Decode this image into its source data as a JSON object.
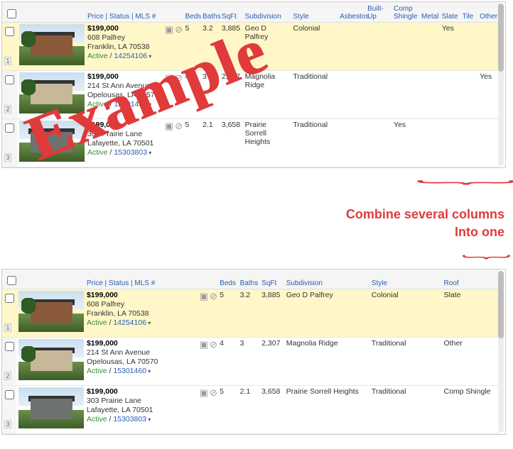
{
  "top": {
    "headers": {
      "price_status_mls": "Price | Status | MLS #",
      "beds": "Beds",
      "baths": "Baths",
      "sqft": "SqFt",
      "subdivision": "Subdivision",
      "style": "Style",
      "asbestos": "Asbestos",
      "builtup": "Built-Up",
      "comp_shingle": "Comp Shingle",
      "metal": "Metal",
      "slate": "Slate",
      "tile": "Tile",
      "other": "Other"
    },
    "rows": [
      {
        "num": "1",
        "price": "$199,000",
        "addr1": "608 Palfrey",
        "addr2": "Franklin, LA 70538",
        "status": "Active",
        "sep": " / ",
        "mls": "14254106",
        "beds": "5",
        "baths": "3.2",
        "sqft": "3,885",
        "subdivision": "Geo D Palfrey",
        "style": "Colonial",
        "asbestos": "",
        "builtup": "",
        "comp": "",
        "metal": "",
        "slate": "Yes",
        "tile": "",
        "other": "",
        "hl": true,
        "photo": "p1"
      },
      {
        "num": "2",
        "price": "$199,000",
        "addr1": "214 St Ann Avenue",
        "addr2": "Opelousas, LA 70570",
        "status": "Active",
        "sep": " / ",
        "mls": "15301460",
        "beds": "4",
        "baths": "3",
        "sqft": "2,307",
        "subdivision": "Magnolia Ridge",
        "style": "Traditional",
        "asbestos": "",
        "builtup": "",
        "comp": "",
        "metal": "",
        "slate": "",
        "tile": "",
        "other": "Yes",
        "hl": false,
        "photo": "p2"
      },
      {
        "num": "3",
        "price": "$199,000",
        "addr1": "303 Prairie Lane",
        "addr2": "Lafayette, LA 70501",
        "status": "Active",
        "sep": " / ",
        "mls": "15303803",
        "beds": "5",
        "baths": "2.1",
        "sqft": "3,658",
        "subdivision": "Prairie Sorrell Heights",
        "style": "Traditional",
        "asbestos": "",
        "builtup": "",
        "comp": "Yes",
        "metal": "",
        "slate": "",
        "tile": "",
        "other": "",
        "hl": false,
        "photo": "p3"
      }
    ]
  },
  "annotations": {
    "example": "Example",
    "combine_text": "Combine several columns",
    "into_one": "Into one",
    "brace_glyph": "︸"
  },
  "bottom": {
    "headers": {
      "price_status_mls": "Price | Status | MLS #",
      "beds": "Beds",
      "baths": "Baths",
      "sqft": "SqFt",
      "subdivision": "Subdivision",
      "style": "Style",
      "roof": "Roof"
    },
    "rows": [
      {
        "num": "1",
        "price": "$199,000",
        "addr1": "608 Palfrey",
        "addr2": "Franklin, LA 70538",
        "status": "Active",
        "sep": " / ",
        "mls": "14254106",
        "beds": "5",
        "baths": "3.2",
        "sqft": "3,885",
        "subdivision": "Geo D Palfrey",
        "style": "Colonial",
        "roof": "Slate",
        "hl": true,
        "photo": "p1"
      },
      {
        "num": "2",
        "price": "$199,000",
        "addr1": "214 St Ann Avenue",
        "addr2": "Opelousas, LA 70570",
        "status": "Active",
        "sep": " / ",
        "mls": "15301460",
        "beds": "4",
        "baths": "3",
        "sqft": "2,307",
        "subdivision": "Magnolia Ridge",
        "style": "Traditional",
        "roof": "Other",
        "hl": false,
        "photo": "p2"
      },
      {
        "num": "3",
        "price": "$199,000",
        "addr1": "303 Prairie Lane",
        "addr2": "Lafayette, LA 70501",
        "status": "Active",
        "sep": " / ",
        "mls": "15303803",
        "beds": "5",
        "baths": "2.1",
        "sqft": "3,658",
        "subdivision": "Prairie Sorrell Heights",
        "style": "Traditional",
        "roof": "Comp Shingle",
        "hl": false,
        "photo": "p3"
      }
    ]
  },
  "icons": {
    "set": "💼⊘📝"
  }
}
